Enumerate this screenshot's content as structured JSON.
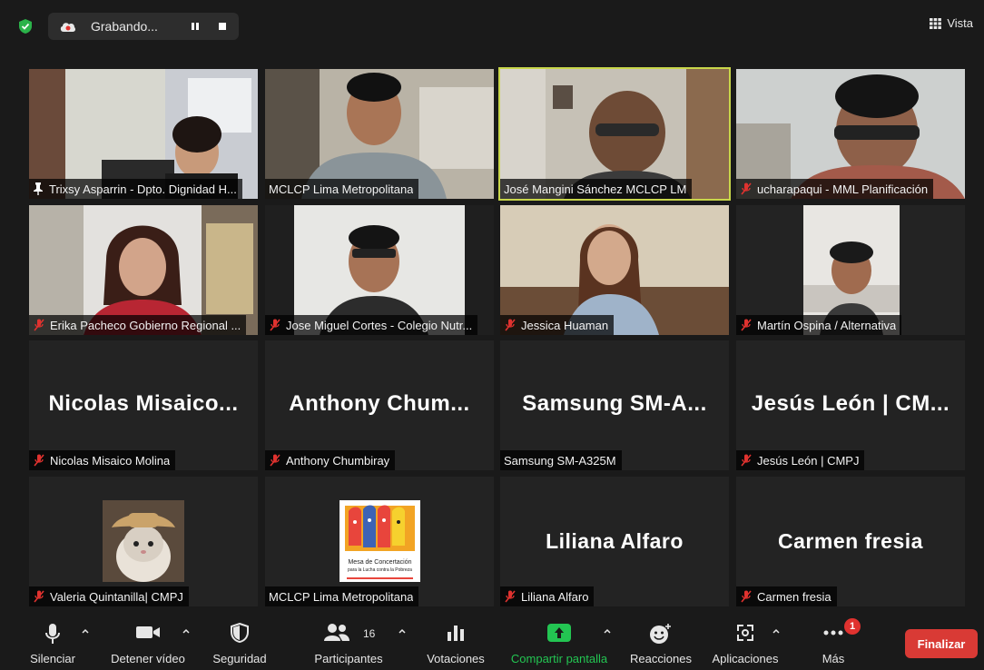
{
  "recording": {
    "label": "Grabando..."
  },
  "view_button": {
    "label": "Vista"
  },
  "participants": [
    {
      "name": "Trixsy Asparrin - Dpto. Dignidad H...",
      "pinned": true,
      "muted": false,
      "video": true
    },
    {
      "name": "MCLCP Lima Metropolitana",
      "pinned": false,
      "muted": false,
      "video": true
    },
    {
      "name": "José Mangini Sánchez MCLCP LM",
      "pinned": false,
      "muted": false,
      "video": true,
      "active_speaker": true
    },
    {
      "name": "ucharapaqui - MML Planificación",
      "pinned": false,
      "muted": true,
      "video": true
    },
    {
      "name": "Erika Pacheco Gobierno Regional ...",
      "muted": true,
      "video": true
    },
    {
      "name": "Jose Miguel Cortes - Colegio Nutr...",
      "muted": true,
      "video": true
    },
    {
      "name": "Jessica Huaman",
      "muted": true,
      "video": true
    },
    {
      "name": "Martín Ospina / Alternativa",
      "muted": true,
      "video": true
    },
    {
      "name": "Nicolas Misaico Molina",
      "display": "Nicolas  Misaico...",
      "muted": true,
      "video": false
    },
    {
      "name": "Anthony Chumbiray",
      "display": "Anthony  Chum...",
      "muted": true,
      "video": false
    },
    {
      "name": "Samsung SM-A325M",
      "display": "Samsung  SM-A...",
      "muted": false,
      "video": false
    },
    {
      "name": "Jesús León | CMPJ",
      "display": "Jesús León | CM...",
      "muted": true,
      "video": false
    },
    {
      "name": "Valeria Quintanilla| CMPJ",
      "muted": true,
      "video": false,
      "avatar": "cat"
    },
    {
      "name": "MCLCP Lima Metropolitana",
      "muted": false,
      "video": false,
      "avatar": "logo"
    },
    {
      "name": "Liliana Alfaro",
      "display": "Liliana Alfaro",
      "muted": true,
      "video": false
    },
    {
      "name": "Carmen fresia",
      "display": "Carmen fresia",
      "muted": true,
      "video": false
    }
  ],
  "logo": {
    "line1": "Mesa de Concertación",
    "line2": "para la Lucha contra la Pobreza"
  },
  "toolbar": {
    "mute": "Silenciar",
    "video": "Detener vídeo",
    "security": "Seguridad",
    "participants": "Participantes",
    "participants_count": "16",
    "polls": "Votaciones",
    "share": "Compartir pantalla",
    "reactions": "Reacciones",
    "apps": "Aplicaciones",
    "more": "Más",
    "more_badge": "1",
    "end": "Finalizar"
  },
  "colors": {
    "background": "#1a1a1a",
    "tile": "#232323",
    "active_speaker": "#c8d64a",
    "share_green": "#23c552",
    "end_red": "#d93a35",
    "muted_red": "#e0322f",
    "security_green": "#2bb34a"
  }
}
